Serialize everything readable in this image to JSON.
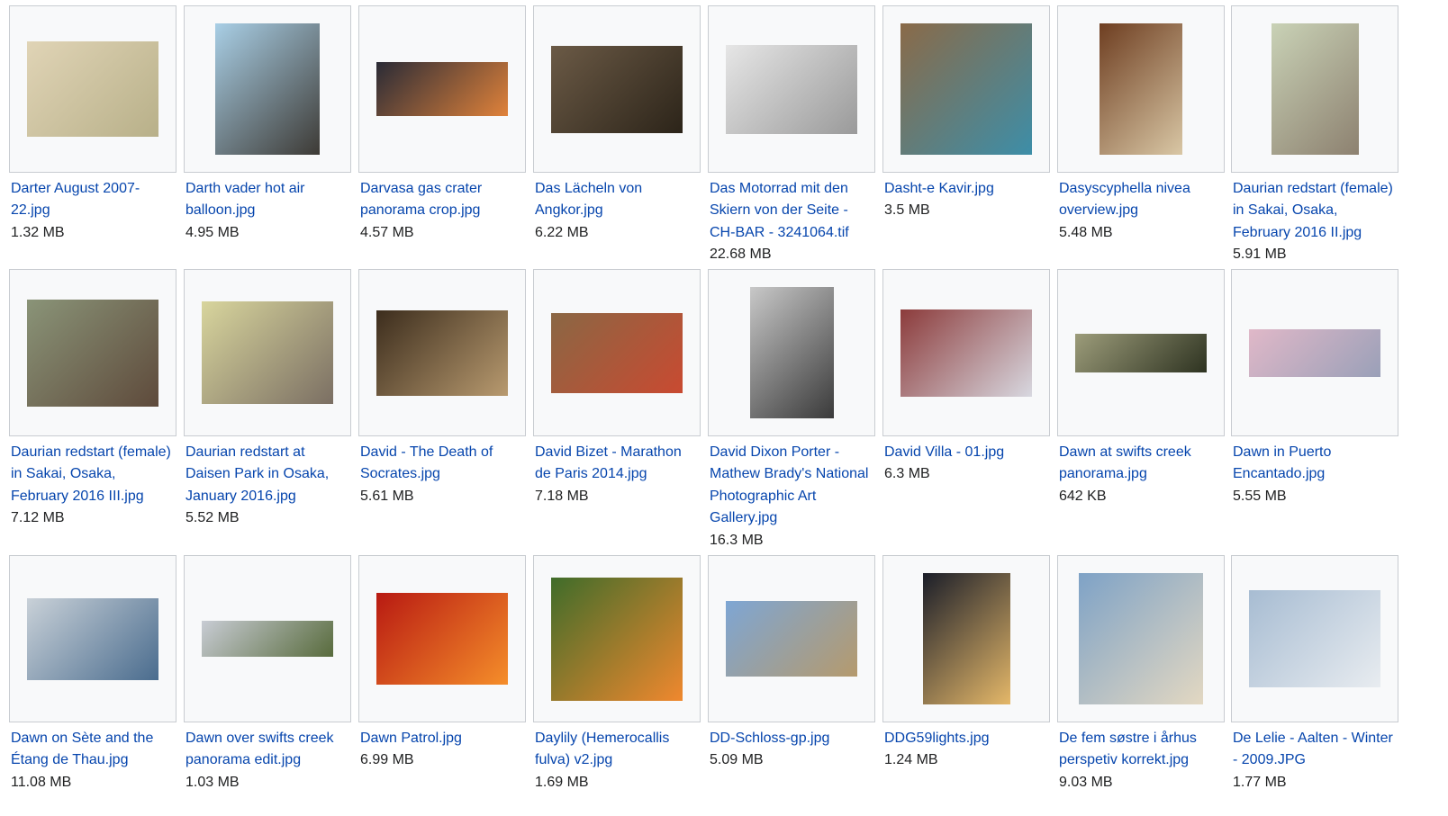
{
  "colors": {
    "link": "#0645ad",
    "text": "#202122",
    "border": "#c8ccd1",
    "thumb_bg": "#f8f9fa"
  },
  "rows": [
    [
      {
        "name": "Darter August 2007-22.jpg",
        "size": "1.32 MB",
        "w": 146,
        "h": 106,
        "thumb_colors": [
          "#e0d4b6",
          "#b8b089"
        ]
      },
      {
        "name": "Darth vader hot air balloon.jpg",
        "size": "4.95 MB",
        "w": 116,
        "h": 146,
        "thumb_colors": [
          "#a9cfe6",
          "#3d3a35"
        ]
      },
      {
        "name": "Darvasa gas crater panorama crop.jpg",
        "size": "4.57 MB",
        "w": 146,
        "h": 60,
        "thumb_colors": [
          "#2a2b36",
          "#e0823a"
        ]
      },
      {
        "name": "Das Lächeln von Angkor.jpg",
        "size": "6.22 MB",
        "w": 146,
        "h": 97,
        "thumb_colors": [
          "#6b5a46",
          "#2c2419"
        ]
      },
      {
        "name": "Das Motorrad mit den Skiern von der Seite - CH-BAR - 3241064.tif",
        "size": "22.68 MB",
        "w": 146,
        "h": 99,
        "thumb_colors": [
          "#e6e6e6",
          "#9a9a9a"
        ]
      },
      {
        "name": "Dasht-e Kavir.jpg",
        "size": "3.5 MB",
        "w": 146,
        "h": 146,
        "thumb_colors": [
          "#8a6a48",
          "#3d8ea8"
        ]
      },
      {
        "name": "Dasyscyphella nivea overview.jpg",
        "size": "5.48 MB",
        "w": 92,
        "h": 146,
        "thumb_colors": [
          "#6e3e21",
          "#d9c7a5"
        ]
      },
      {
        "name": "Daurian redstart (female) in Sakai, Osaka, February 2016 II.jpg",
        "size": "5.91 MB",
        "w": 97,
        "h": 146,
        "thumb_colors": [
          "#c9d2b6",
          "#8d8170"
        ]
      }
    ],
    [
      {
        "name": "Daurian redstart (female) in Sakai, Osaka, February 2016 III.jpg",
        "size": "7.12 MB",
        "w": 146,
        "h": 119,
        "thumb_colors": [
          "#8a9478",
          "#5e4a3b"
        ]
      },
      {
        "name": "Daurian redstart at Daisen Park in Osaka, January 2016.jpg",
        "size": "5.52 MB",
        "w": 146,
        "h": 114,
        "thumb_colors": [
          "#d8d59d",
          "#7b6f63"
        ]
      },
      {
        "name": "David - The Death of Socrates.jpg",
        "size": "5.61 MB",
        "w": 146,
        "h": 95,
        "thumb_colors": [
          "#3c2d1d",
          "#b89a6f"
        ]
      },
      {
        "name": "David Bizet - Marathon de Paris 2014.jpg",
        "size": "7.18 MB",
        "w": 146,
        "h": 89,
        "thumb_colors": [
          "#8a6744",
          "#c94a31"
        ]
      },
      {
        "name": "David Dixon Porter - Mathew Brady's National Photographic Art Gallery.jpg",
        "size": "16.3 MB",
        "w": 93,
        "h": 146,
        "thumb_colors": [
          "#c8c8c8",
          "#3a3a3a"
        ]
      },
      {
        "name": "David Villa - 01.jpg",
        "size": "6.3 MB",
        "w": 146,
        "h": 97,
        "thumb_colors": [
          "#8c3b3b",
          "#d8d8e0"
        ]
      },
      {
        "name": "Dawn at swifts creek panorama.jpg",
        "size": "642 KB",
        "w": 146,
        "h": 43,
        "thumb_colors": [
          "#9c9c7a",
          "#2e3321"
        ]
      },
      {
        "name": "Dawn in Puerto Encantado.jpg",
        "size": "5.55 MB",
        "w": 146,
        "h": 53,
        "thumb_colors": [
          "#e0b8c8",
          "#9aa0b8"
        ]
      }
    ],
    [
      {
        "name": "Dawn on Sète and the Étang de Thau.jpg",
        "size": "11.08 MB",
        "w": 146,
        "h": 91,
        "thumb_colors": [
          "#c9d1d8",
          "#4a6c8e"
        ]
      },
      {
        "name": "Dawn over swifts creek panorama edit.jpg",
        "size": "1.03 MB",
        "w": 146,
        "h": 40,
        "thumb_colors": [
          "#c8ccd4",
          "#586b3c"
        ]
      },
      {
        "name": "Dawn Patrol.jpg",
        "size": "6.99 MB",
        "w": 146,
        "h": 102,
        "thumb_colors": [
          "#b81a12",
          "#f58e2a"
        ]
      },
      {
        "name": "Daylily (Hemerocallis fulva) v2.jpg",
        "size": "1.69 MB",
        "w": 146,
        "h": 137,
        "thumb_colors": [
          "#3f6c2a",
          "#f0882e"
        ]
      },
      {
        "name": "DD-Schloss-gp.jpg",
        "size": "5.09 MB",
        "w": 146,
        "h": 84,
        "thumb_colors": [
          "#7ea6d4",
          "#b59a6d"
        ]
      },
      {
        "name": "DDG59lights.jpg",
        "size": "1.24 MB",
        "w": 97,
        "h": 146,
        "thumb_colors": [
          "#1b1e29",
          "#e5b869"
        ]
      },
      {
        "name": "De fem søstre i århus perspetiv korrekt.jpg",
        "size": "9.03 MB",
        "w": 138,
        "h": 146,
        "thumb_colors": [
          "#7ea2c6",
          "#e3d8c2"
        ]
      },
      {
        "name": "De Lelie - Aalten - Winter - 2009.JPG",
        "size": "1.77 MB",
        "w": 146,
        "h": 108,
        "thumb_colors": [
          "#a7bcd2",
          "#e8ecf0"
        ]
      }
    ]
  ]
}
